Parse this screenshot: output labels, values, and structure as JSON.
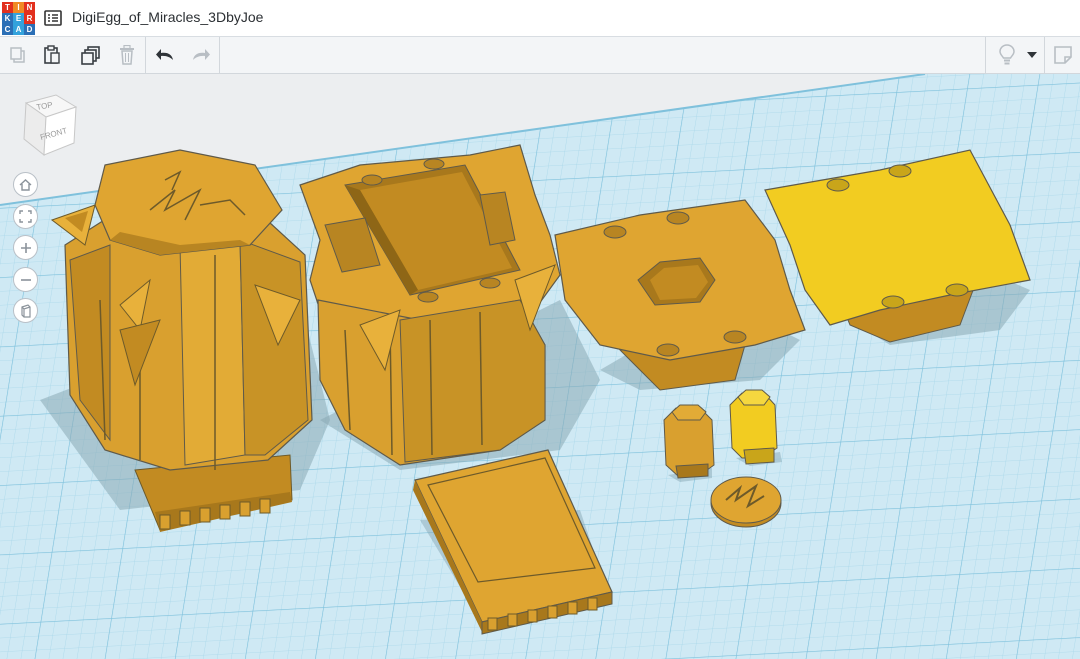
{
  "app": {
    "logo_letters": [
      "T",
      "I",
      "N",
      "K",
      "E",
      "R",
      "C",
      "A",
      "D"
    ],
    "logo_colors": [
      "#e2301e",
      "#f08a24",
      "#e2301e",
      "#2b6fb6",
      "#33a2dc",
      "#e2301e",
      "#2b6fb6",
      "#33a2dc",
      "#2b6fb6"
    ],
    "title": "DigiEgg_of_Miracles_3DbyJoe"
  },
  "toolbar": {
    "left_icons": [
      "copy-icon",
      "paste-icon",
      "duplicate-icon",
      "trash-icon",
      "undo-icon",
      "redo-icon"
    ],
    "right_icons": [
      "lightbulb-icon",
      "dropdown-caret-icon",
      "notes-icon"
    ]
  },
  "viewcube": {
    "top_label": "TOP",
    "front_label": "FRONT"
  },
  "nav_controls": [
    "home-view-icon",
    "fit-all-icon",
    "zoom-in-icon",
    "zoom-out-icon",
    "ortho-view-icon"
  ],
  "colors": {
    "grid_fill": "#cfe9f4",
    "grid_line": "#9fd2e6",
    "part_orange": "#d9a02f",
    "part_yellow": "#f2cc21",
    "accent": "#2b6fb6"
  }
}
